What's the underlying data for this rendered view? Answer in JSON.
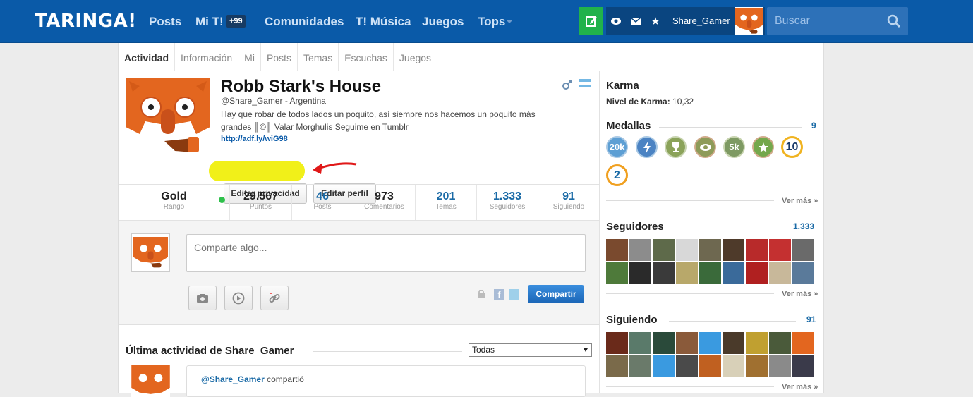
{
  "header": {
    "logo": "TARINGA!",
    "nav": [
      "Posts",
      "Mi T!",
      "Comunidades",
      "T! Música",
      "Juegos",
      "Tops"
    ],
    "badge": "+99",
    "username": "Share_Gamer",
    "search_placeholder": "Buscar"
  },
  "tabs": [
    "Actividad",
    "Información",
    "Mi",
    "Posts",
    "Temas",
    "Escuchas",
    "Juegos"
  ],
  "profile": {
    "name": "Robb Stark's House",
    "handle_country": "@Share_Gamer - Argentina",
    "bio": "Hay que robar de todos lados un poquito, así siempre nos hacemos un poquito más grandes ║©║ Valar Morghulis Seguime en Tumblr",
    "link": "http://adf.ly/wiG98",
    "btn_privacy": "Editar privacidad",
    "btn_profile": "Editar perfil"
  },
  "stats": [
    {
      "value": "Gold",
      "label": "Rango"
    },
    {
      "value": "29.567",
      "label": "Puntos"
    },
    {
      "value": "46",
      "label": "Posts"
    },
    {
      "value": "973",
      "label": "Comentarios"
    },
    {
      "value": "201",
      "label": "Temas"
    },
    {
      "value": "1.333",
      "label": "Seguidores"
    },
    {
      "value": "91",
      "label": "Siguiendo"
    }
  ],
  "composer": {
    "placeholder": "Comparte algo...",
    "share_label": "Compartir"
  },
  "activity": {
    "title": "Última actividad de Share_Gamer",
    "filter": "Todas",
    "user": "@Share_Gamer",
    "action": " compartió"
  },
  "sidebar": {
    "karma_title": "Karma",
    "karma_label": "Nivel de Karma:",
    "karma_value": "10,32",
    "medals_title": "Medallas",
    "medals_count": "9",
    "medals": [
      "20k",
      "",
      "",
      "",
      "5k",
      "",
      "10",
      "2",
      ""
    ],
    "followers_title": "Seguidores",
    "followers_count": "1.333",
    "following_title": "Siguiendo",
    "following_count": "91",
    "more": "Ver más »"
  },
  "colors": {
    "topbar": "#0a5aa8",
    "accent": "#1a6aa6",
    "green": "#21b24b"
  }
}
